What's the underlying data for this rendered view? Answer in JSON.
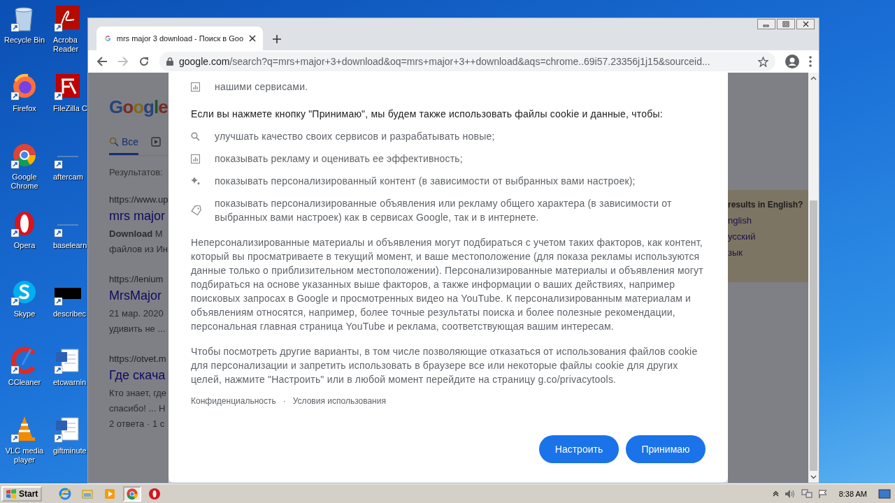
{
  "desktop_icons": [
    {
      "label": "Recycle Bin",
      "kind": "recycle"
    },
    {
      "label": "Acroba Reader",
      "kind": "acrobat"
    },
    {
      "label": "Firefox",
      "kind": "firefox"
    },
    {
      "label": "FileZilla C",
      "kind": "filezilla"
    },
    {
      "label": "Google Chrome",
      "kind": "chrome"
    },
    {
      "label": "aftercam",
      "kind": "file"
    },
    {
      "label": "Opera",
      "kind": "opera"
    },
    {
      "label": "baselearn",
      "kind": "file"
    },
    {
      "label": "Skype",
      "kind": "skype"
    },
    {
      "label": "describec",
      "kind": "black"
    },
    {
      "label": "CCleaner",
      "kind": "ccleaner"
    },
    {
      "label": "etcwarnin",
      "kind": "word"
    },
    {
      "label": "VLC media player",
      "kind": "vlc"
    },
    {
      "label": "giftminute",
      "kind": "word"
    }
  ],
  "browser": {
    "tab_title": "mrs major 3 download - Поиск в Goo",
    "url_host": "google.com",
    "url_path": "/search?q=mrs+major+3+download&oq=mrs+major+3++download&aqs=chrome..69i57.23356j1j15&sourceid..."
  },
  "background_page": {
    "logo": "Google",
    "tabs": [
      {
        "label": "Все",
        "selected": true
      },
      {
        "selected": false
      }
    ],
    "result_count": "Результатов:",
    "results": [
      {
        "url": "https://www.up",
        "title": "mrs major",
        "snippet": [
          "**Download** M",
          "файлов из Ин"
        ]
      },
      {
        "url": "https://lenium",
        "title": "MrsMajor",
        "snippet": [
          "21 мар. 2020",
          "удивить не ..."
        ]
      },
      {
        "url": "https://otvet.m",
        "title": "Где скача",
        "snippet": [
          "Кто знает, где",
          "спасибо! ... Н",
          "2 ответа · 1 с"
        ]
      }
    ],
    "language_panel": {
      "title": "results in English?",
      "options": [
        "nglish",
        "усский",
        "зык"
      ]
    }
  },
  "consent": {
    "top_item": {
      "kind": "chart",
      "text": "нашими сервисами."
    },
    "heading": "Если вы нажмете кнопку \"Принимаю\", мы будем также использовать файлы cookie и данные, чтобы:",
    "items": [
      {
        "kind": "search",
        "text": "улучшать качество своих сервисов и разрабатывать новые;"
      },
      {
        "kind": "chart",
        "text": "показывать рекламу и оценивать ее эффективность;"
      },
      {
        "kind": "sparkle",
        "text": "показывать персонализированный контент (в зависимости от выбранных вами настроек);"
      },
      {
        "kind": "tag",
        "text": "показывать персонализированные объявления или рекламу общего характера (в зависимости от выбранных вами настроек) как в сервисах Google, так и в интернете."
      }
    ],
    "paragraphs": [
      "Неперсонализированные материалы и объявления могут подбираться с учетом таких факторов, как контент, который вы просматриваете в текущий момент, и ваше местоположение (для показа рекламы используются данные только о приблизительном местоположении). Персонализированные материалы и объявления могут подбираться на основе указанных выше факторов, а также информации о ваших действиях, например поисковых запросах в Google и просмотренных видео на YouTube. К персонализированным материалам и объявлениям относятся, например, более точные результаты поиска и более полезные рекомендации, персональная главная страница YouTube и реклама, соответствующая вашим интересам.",
      "Чтобы посмотреть другие варианты, в том числе позволяющие отказаться от использования файлов cookie для персонализации и запретить использовать в браузере все или некоторые файлы cookie для других целей, нажмите \"Настроить\" или в любой момент перейдите на страницу g.co/privacytools."
    ],
    "links": [
      "Конфиденциальность",
      "Условия использования"
    ],
    "link_separator": "·",
    "buttons": [
      "Настроить",
      "Принимаю"
    ]
  },
  "taskbar": {
    "start": "Start",
    "quick_launch": [
      {
        "kind": "ie",
        "selected": false
      },
      {
        "kind": "explorer",
        "selected": false
      },
      {
        "kind": "media",
        "selected": false
      },
      {
        "kind": "chrome",
        "selected": true
      },
      {
        "kind": "opera",
        "selected": false
      }
    ],
    "clock": "8:38 AM"
  }
}
